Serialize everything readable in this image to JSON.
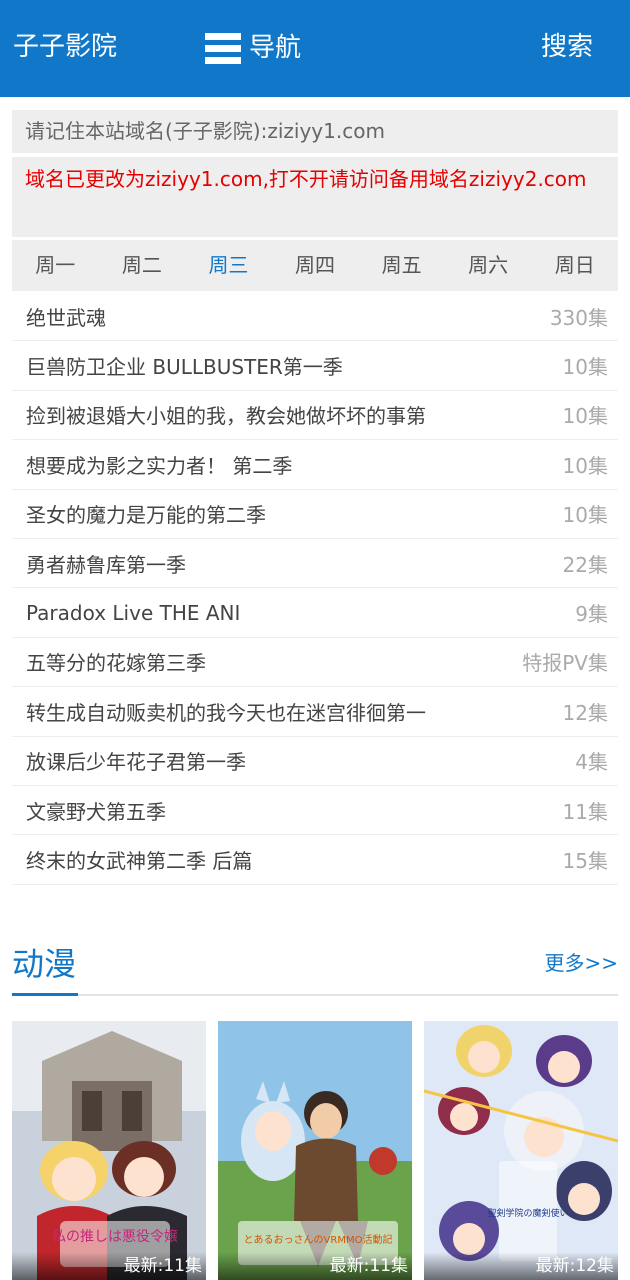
{
  "header": {
    "site_title": "子子影院",
    "nav_label": "导航",
    "search_label": "搜索"
  },
  "notices": {
    "domain_reminder": "请记住本站域名(子子影院):ziziyy1.com",
    "domain_change": "域名已更改为ziziyy1.com,打不开请访问备用域名ziziyy2.com"
  },
  "weekdays": {
    "active": "周三",
    "days": [
      "周一",
      "周二",
      "周三",
      "周四",
      "周五",
      "周六",
      "周日"
    ]
  },
  "schedule": [
    {
      "title": "绝世武魂",
      "episodes": "330集"
    },
    {
      "title": "巨兽防卫企业 BULLBUSTER第一季",
      "episodes": "10集"
    },
    {
      "title": "捡到被退婚大小姐的我，教会她做坏坏的事第",
      "episodes": "10集"
    },
    {
      "title": "想要成为影之实力者！ 第二季",
      "episodes": "10集"
    },
    {
      "title": "圣女的魔力是万能的第二季",
      "episodes": "10集"
    },
    {
      "title": "勇者赫鲁库第一季",
      "episodes": "22集"
    },
    {
      "title": "Paradox Live THE ANI",
      "episodes": "9集"
    },
    {
      "title": "五等分的花嫁第三季",
      "episodes": "特报PV集"
    },
    {
      "title": "转生成自动贩卖机的我今天也在迷宫徘徊第一",
      "episodes": "12集"
    },
    {
      "title": "放课后少年花子君第一季",
      "episodes": "4集"
    },
    {
      "title": "文豪野犬第五季",
      "episodes": "11集"
    },
    {
      "title": "终末的女武神第二季 后篇",
      "episodes": "15集"
    }
  ],
  "anime_section": {
    "title": "动漫",
    "more_label": "更多>>",
    "cards": [
      {
        "latest": "最新:11集",
        "poster_text": "私の推しは悪役令嬢"
      },
      {
        "latest": "最新:11集",
        "poster_text": "とあるおっさんのVRMMO活動記"
      },
      {
        "latest": "最新:12集",
        "poster_text": "聖剣学院の魔剣使い"
      }
    ]
  },
  "colors": {
    "brand_blue": "#1178c9",
    "notice_red": "#e60000",
    "panel_gray": "#eeeeee"
  }
}
